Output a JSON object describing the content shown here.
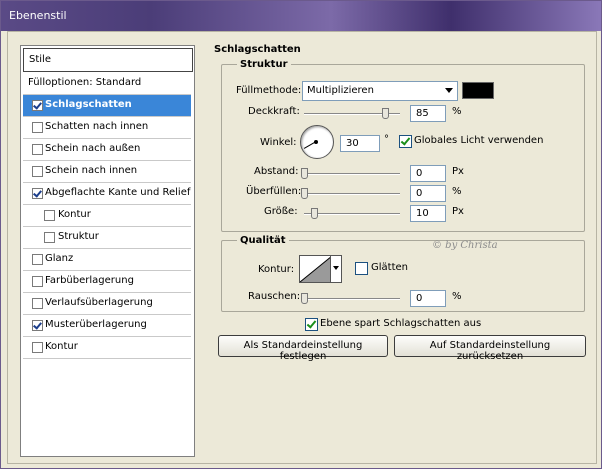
{
  "window": {
    "title": "Ebenenstil"
  },
  "styles_panel": {
    "header": "Stile",
    "items": [
      {
        "label": "Fülloptionen: Standard",
        "checkbox": false,
        "checked": false,
        "indent": false,
        "selected": false
      },
      {
        "label": "Schlagschatten",
        "checkbox": true,
        "checked": true,
        "indent": false,
        "selected": true
      },
      {
        "label": "Schatten nach innen",
        "checkbox": true,
        "checked": false,
        "indent": false,
        "selected": false
      },
      {
        "label": "Schein nach außen",
        "checkbox": true,
        "checked": false,
        "indent": false,
        "selected": false
      },
      {
        "label": "Schein nach innen",
        "checkbox": true,
        "checked": false,
        "indent": false,
        "selected": false
      },
      {
        "label": "Abgeflachte Kante und Relief",
        "checkbox": true,
        "checked": true,
        "indent": false,
        "selected": false
      },
      {
        "label": "Kontur",
        "checkbox": true,
        "checked": false,
        "indent": true,
        "selected": false
      },
      {
        "label": "Struktur",
        "checkbox": true,
        "checked": false,
        "indent": true,
        "selected": false
      },
      {
        "label": "Glanz",
        "checkbox": true,
        "checked": false,
        "indent": false,
        "selected": false
      },
      {
        "label": "Farbüberlagerung",
        "checkbox": true,
        "checked": false,
        "indent": false,
        "selected": false
      },
      {
        "label": "Verlaufsüberlagerung",
        "checkbox": true,
        "checked": false,
        "indent": false,
        "selected": false
      },
      {
        "label": "Musterüberlagerung",
        "checkbox": true,
        "checked": true,
        "indent": false,
        "selected": false
      },
      {
        "label": "Kontur",
        "checkbox": true,
        "checked": false,
        "indent": false,
        "selected": false
      }
    ]
  },
  "drop_shadow": {
    "section_title": "Schlagschatten",
    "structure": {
      "title": "Struktur",
      "blend_mode_label": "Füllmethode:",
      "blend_mode_value": "Multiplizieren",
      "shadow_color": "#000000",
      "opacity_label": "Deckkraft:",
      "opacity_value": "85",
      "opacity_unit": "%",
      "angle_label": "Winkel:",
      "angle_value": "30",
      "angle_unit": "°",
      "global_light_label": "Globales Licht verwenden",
      "global_light_checked": true,
      "distance_label": "Abstand:",
      "distance_value": "0",
      "distance_unit": "Px",
      "spread_label": "Überfüllen:",
      "spread_value": "0",
      "spread_unit": "%",
      "size_label": "Größe:",
      "size_value": "10",
      "size_unit": "Px"
    },
    "quality": {
      "title": "Qualität",
      "contour_label": "Kontur:",
      "antialias_label": "Glätten",
      "antialias_checked": false,
      "noise_label": "Rauschen:",
      "noise_value": "0",
      "noise_unit": "%"
    },
    "knockout_label": "Ebene spart Schlagschatten aus",
    "knockout_checked": true,
    "make_default_button": "Als Standardeinstellung festlegen",
    "reset_default_button": "Auf Standardeinstellung zurücksetzen"
  },
  "watermark": "© by Christa"
}
